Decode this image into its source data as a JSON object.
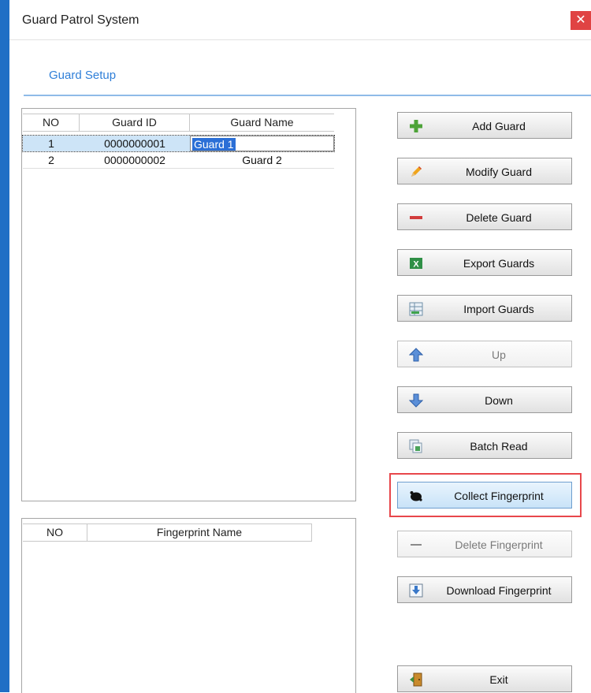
{
  "window": {
    "title": "Guard Patrol System",
    "close_glyph": "✕"
  },
  "tab": {
    "label": "Guard Setup"
  },
  "guard_table": {
    "columns": [
      "NO",
      "Guard ID",
      "Guard Name"
    ],
    "rows": [
      {
        "no": "1",
        "id": "0000000001",
        "name": "Guard 1",
        "selected": true,
        "editing": true
      },
      {
        "no": "2",
        "id": "0000000002",
        "name": "Guard 2",
        "selected": false,
        "editing": false
      }
    ]
  },
  "fingerprint_table": {
    "columns": [
      "NO",
      "Fingerprint Name"
    ],
    "rows": []
  },
  "buttons": [
    {
      "label": "Add Guard",
      "icon": "plus-icon",
      "enabled": true
    },
    {
      "label": "Modify Guard",
      "icon": "pencil-icon",
      "enabled": true
    },
    {
      "label": "Delete Guard",
      "icon": "minus-icon",
      "enabled": true
    },
    {
      "label": "Export Guards",
      "icon": "excel-icon",
      "enabled": true
    },
    {
      "label": "Import Guards",
      "icon": "spreadsheet-import-icon",
      "enabled": true
    },
    {
      "label": "Up",
      "icon": "arrow-up-icon",
      "enabled": false
    },
    {
      "label": "Down",
      "icon": "arrow-down-icon",
      "enabled": true
    },
    {
      "label": "Batch Read",
      "icon": "batch-read-icon",
      "enabled": true
    },
    {
      "label": "Collect Fingerprint",
      "icon": "fingerprint-icon",
      "enabled": true,
      "highlighted": true
    },
    {
      "label": "Delete Fingerprint",
      "icon": "minus-icon",
      "enabled": false
    },
    {
      "label": "Download Fingerprint",
      "icon": "download-icon",
      "enabled": true
    },
    {
      "label": "Exit",
      "icon": "exit-door-icon",
      "enabled": true
    }
  ],
  "colors": {
    "accent": "#1f6fc5",
    "tab_text": "#2f7fd8",
    "close": "#e04343",
    "highlight_box": "#e8474b",
    "selection": "#2b6fd6"
  }
}
